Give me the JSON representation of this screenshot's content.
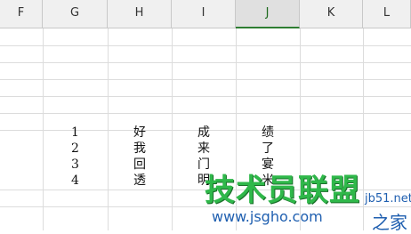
{
  "columns": [
    "F",
    "G",
    "H",
    "I",
    "J",
    "K",
    "L"
  ],
  "active_column": "J",
  "rows": [
    [
      "1",
      "好",
      "成",
      "绩"
    ],
    [
      "2",
      "我",
      "来",
      "了"
    ],
    [
      "3",
      "回",
      "门",
      "宴"
    ],
    [
      "4",
      "透",
      "明",
      "米"
    ]
  ],
  "watermark": {
    "title": "技术员联盟",
    "url": "www.jsgho.com",
    "tld": "jb51.net",
    "suffix": "之家"
  }
}
